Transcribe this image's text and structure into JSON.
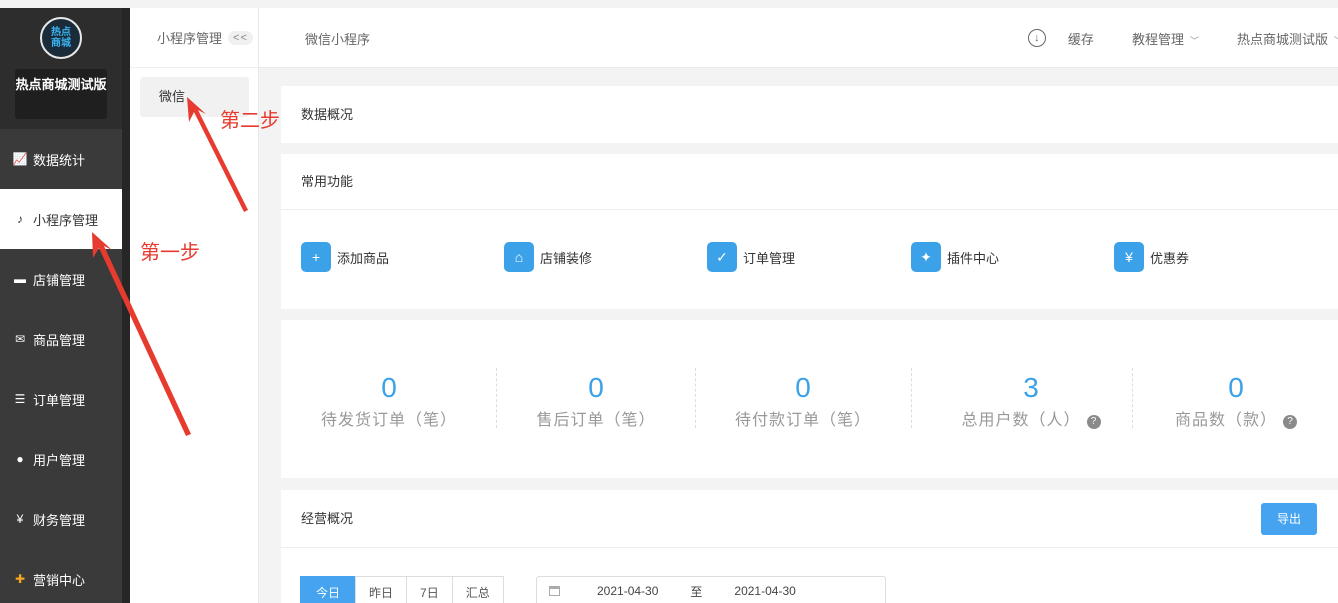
{
  "sidebar": {
    "logo_text": "热点商城",
    "shop_name": "热点商城测试版",
    "items": [
      {
        "label": "数据统计",
        "icon": "chart-line-icon"
      },
      {
        "label": "小程序管理",
        "icon": "miniprogram-icon"
      },
      {
        "label": "店铺管理",
        "icon": "shop-icon"
      },
      {
        "label": "商品管理",
        "icon": "goods-icon"
      },
      {
        "label": "订单管理",
        "icon": "order-icon"
      },
      {
        "label": "用户管理",
        "icon": "user-icon"
      },
      {
        "label": "财务管理",
        "icon": "finance-icon"
      },
      {
        "label": "营销中心",
        "icon": "marketing-icon"
      }
    ],
    "active_index": 1
  },
  "subnav": {
    "title": "小程序管理",
    "collapse": "<<",
    "item": "微信"
  },
  "header": {
    "breadcrumb": "微信小程序",
    "cache": "缓存",
    "tutorial": "教程管理",
    "account": "热点商城测试版"
  },
  "overview_title": "数据概况",
  "functions": {
    "title": "常用功能",
    "items": [
      {
        "label": "添加商品",
        "icon": "add-goods-icon"
      },
      {
        "label": "店铺装修",
        "icon": "store-decor-icon"
      },
      {
        "label": "订单管理",
        "icon": "order-manage-icon"
      },
      {
        "label": "插件中心",
        "icon": "plugin-icon"
      },
      {
        "label": "优惠券",
        "icon": "coupon-icon"
      }
    ]
  },
  "stats": [
    {
      "value": "0",
      "label": "待发货订单（笔）"
    },
    {
      "value": "0",
      "label": "售后订单（笔）"
    },
    {
      "value": "0",
      "label": "待付款订单（笔）"
    },
    {
      "value": "3",
      "label": "总用户数（人）"
    },
    {
      "value": "0",
      "label": "商品数（款）"
    }
  ],
  "business": {
    "title": "经营概况",
    "export": "导出",
    "ranges": [
      "今日",
      "昨日",
      "7日",
      "汇总"
    ],
    "date_from": "2021-04-30",
    "date_sep": "至",
    "date_to": "2021-04-30"
  },
  "annotations": {
    "step1": "第一步",
    "step2": "第二步",
    "color": "#e63b2e"
  }
}
